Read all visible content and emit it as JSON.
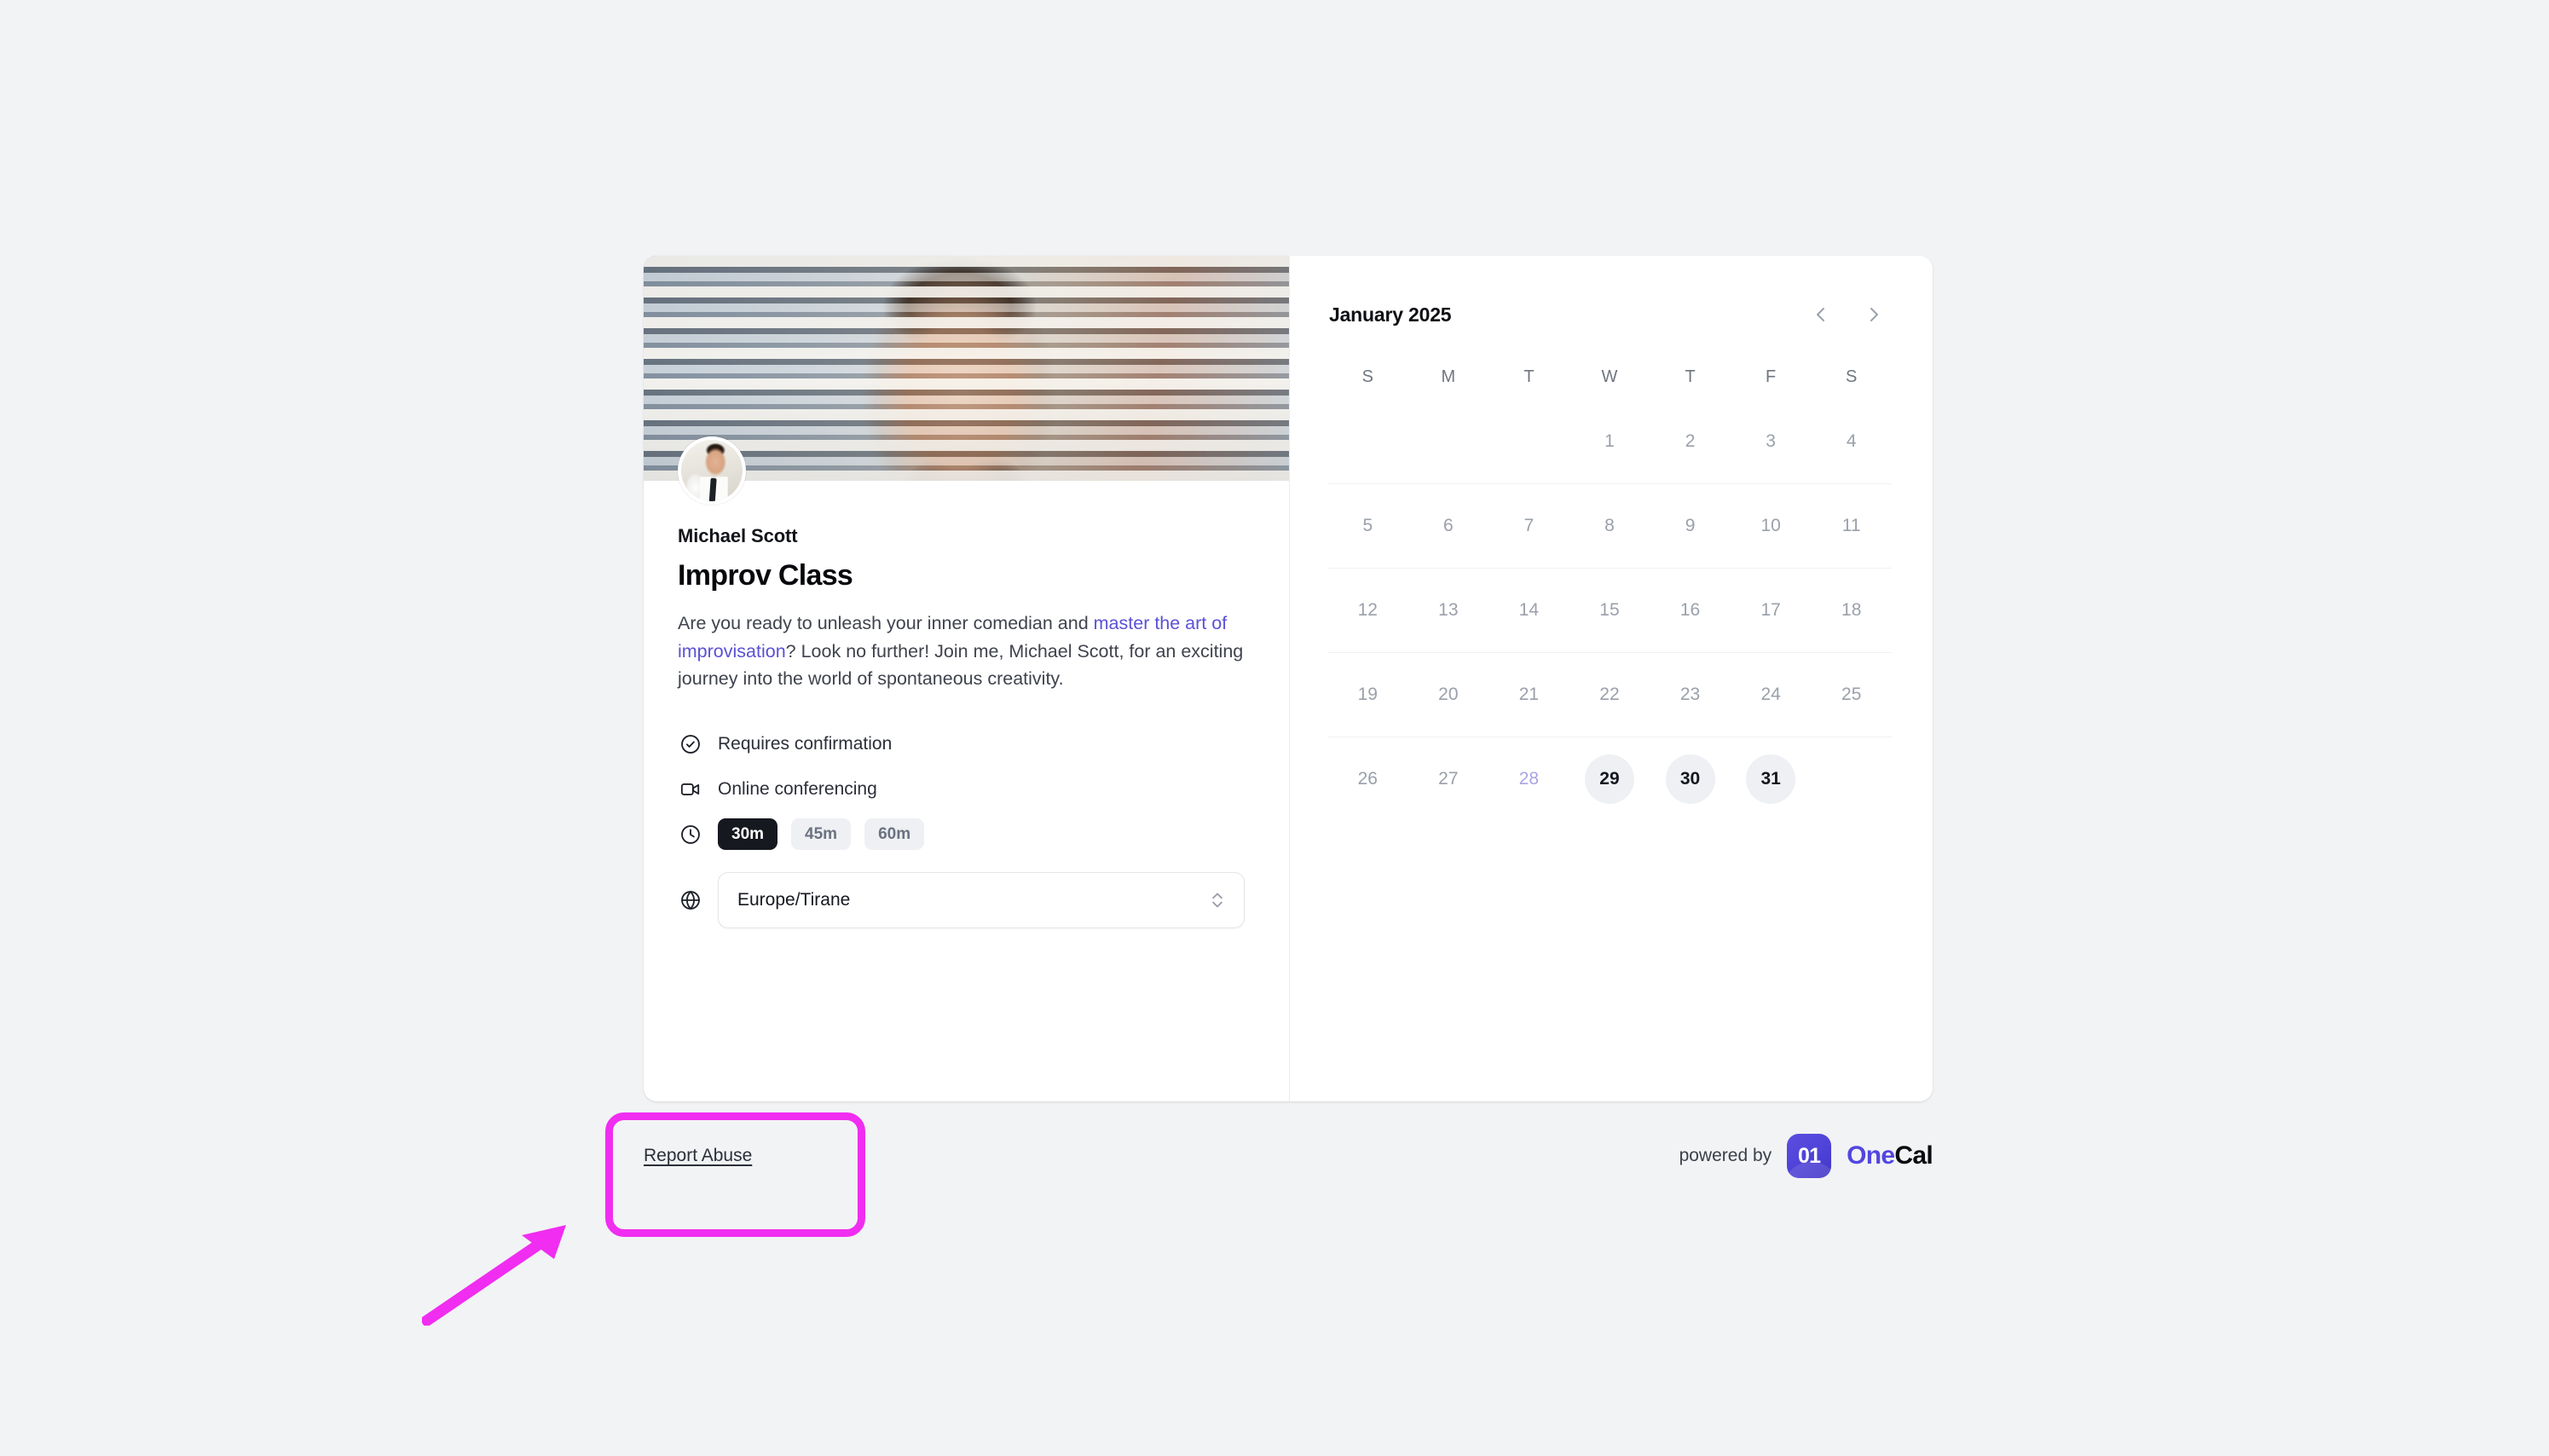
{
  "page": {
    "background_color": "#f2f3f5"
  },
  "booking": {
    "host_name": "Michael Scott",
    "event_title": "Improv Class",
    "description": {
      "before_link": "Are you ready to unleash your inner comedian and ",
      "link_text": "master the art of improvisation",
      "after_link": "? Look no further! Join me, Michael Scott, for an exciting journey into the world of spontaneous creativity."
    },
    "link_color": "#5a51d6",
    "banner_alt": "banner-image",
    "avatar_alt": "host-avatar",
    "meta": {
      "confirmation_label": "Requires confirmation",
      "conferencing_label": "Online conferencing",
      "durations": [
        {
          "label": "30m",
          "active": true
        },
        {
          "label": "45m",
          "active": false
        },
        {
          "label": "60m",
          "active": false
        }
      ],
      "timezone_value": "Europe/Tirane"
    }
  },
  "calendar": {
    "month_label": "January 2025",
    "prev_label": "‹",
    "next_label": "›",
    "weekdays": [
      "S",
      "M",
      "T",
      "W",
      "T",
      "F",
      "S"
    ],
    "weeks": [
      [
        {
          "label": "",
          "state": "empty"
        },
        {
          "label": "",
          "state": "empty"
        },
        {
          "label": "",
          "state": "empty"
        },
        {
          "label": "1",
          "state": "disabled"
        },
        {
          "label": "2",
          "state": "disabled"
        },
        {
          "label": "3",
          "state": "disabled"
        },
        {
          "label": "4",
          "state": "disabled"
        }
      ],
      [
        {
          "label": "5",
          "state": "disabled"
        },
        {
          "label": "6",
          "state": "disabled"
        },
        {
          "label": "7",
          "state": "disabled"
        },
        {
          "label": "8",
          "state": "disabled"
        },
        {
          "label": "9",
          "state": "disabled"
        },
        {
          "label": "10",
          "state": "disabled"
        },
        {
          "label": "11",
          "state": "disabled"
        }
      ],
      [
        {
          "label": "12",
          "state": "disabled"
        },
        {
          "label": "13",
          "state": "disabled"
        },
        {
          "label": "14",
          "state": "disabled"
        },
        {
          "label": "15",
          "state": "disabled"
        },
        {
          "label": "16",
          "state": "disabled"
        },
        {
          "label": "17",
          "state": "disabled"
        },
        {
          "label": "18",
          "state": "disabled"
        }
      ],
      [
        {
          "label": "19",
          "state": "disabled"
        },
        {
          "label": "20",
          "state": "disabled"
        },
        {
          "label": "21",
          "state": "disabled"
        },
        {
          "label": "22",
          "state": "disabled"
        },
        {
          "label": "23",
          "state": "disabled"
        },
        {
          "label": "24",
          "state": "disabled"
        },
        {
          "label": "25",
          "state": "disabled"
        }
      ],
      [
        {
          "label": "26",
          "state": "disabled"
        },
        {
          "label": "27",
          "state": "disabled"
        },
        {
          "label": "28",
          "state": "today-muted"
        },
        {
          "label": "29",
          "state": "available"
        },
        {
          "label": "30",
          "state": "available"
        },
        {
          "label": "31",
          "state": "available"
        },
        {
          "label": "",
          "state": "empty"
        }
      ]
    ]
  },
  "footer": {
    "report_abuse_label": "Report Abuse",
    "powered_by_label": "powered by",
    "logo_text": "01",
    "brand_one": "One",
    "brand_cal": "Cal"
  },
  "annotations": {
    "highlight_color": "#f02df0",
    "target": "report-abuse-link"
  }
}
